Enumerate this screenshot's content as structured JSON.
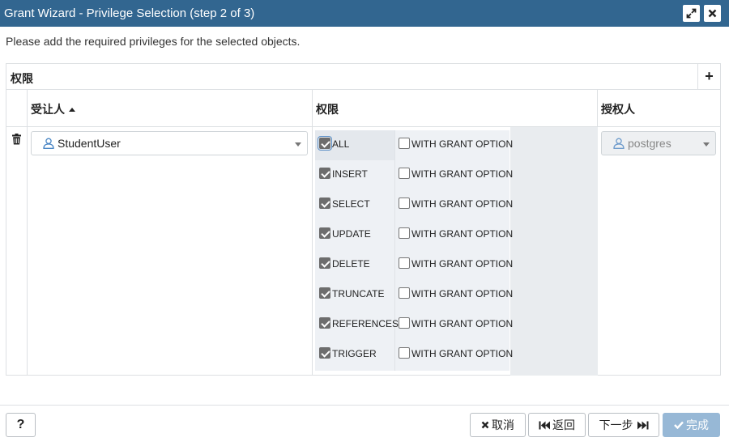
{
  "dialog": {
    "title": "Grant Wizard - Privilege Selection (step 2 of 3)",
    "instruction": "Please add the required privileges for the selected objects."
  },
  "panel": {
    "title": "权限",
    "add_label": "+"
  },
  "columns": {
    "grantee": "受让人",
    "privileges": "权限",
    "grantor": "授权人"
  },
  "row": {
    "grantee": "StudentUser",
    "grantor": "postgres",
    "privileges": [
      {
        "name": "ALL",
        "checked": true,
        "with_grant_option": false
      },
      {
        "name": "INSERT",
        "checked": true,
        "with_grant_option": false
      },
      {
        "name": "SELECT",
        "checked": true,
        "with_grant_option": false
      },
      {
        "name": "UPDATE",
        "checked": true,
        "with_grant_option": false
      },
      {
        "name": "DELETE",
        "checked": true,
        "with_grant_option": false
      },
      {
        "name": "TRUNCATE",
        "checked": true,
        "with_grant_option": false
      },
      {
        "name": "REFERENCES",
        "checked": true,
        "with_grant_option": false
      },
      {
        "name": "TRIGGER",
        "checked": true,
        "with_grant_option": false
      }
    ],
    "with_grant_option_label": "WITH GRANT OPTION"
  },
  "footer": {
    "help": "?",
    "cancel": "取消",
    "back": "返回",
    "next": "下一步",
    "finish": "完成"
  },
  "icons": {
    "expand": "expand-icon",
    "close": "close-icon",
    "add": "plus-icon",
    "delete": "trash-icon",
    "user": "user-icon",
    "cancel": "x-icon",
    "back": "backward-icon",
    "next": "forward-icon",
    "finish": "check-icon"
  },
  "colors": {
    "titlebar": "#326690",
    "finish_button": "#97b8d6"
  }
}
